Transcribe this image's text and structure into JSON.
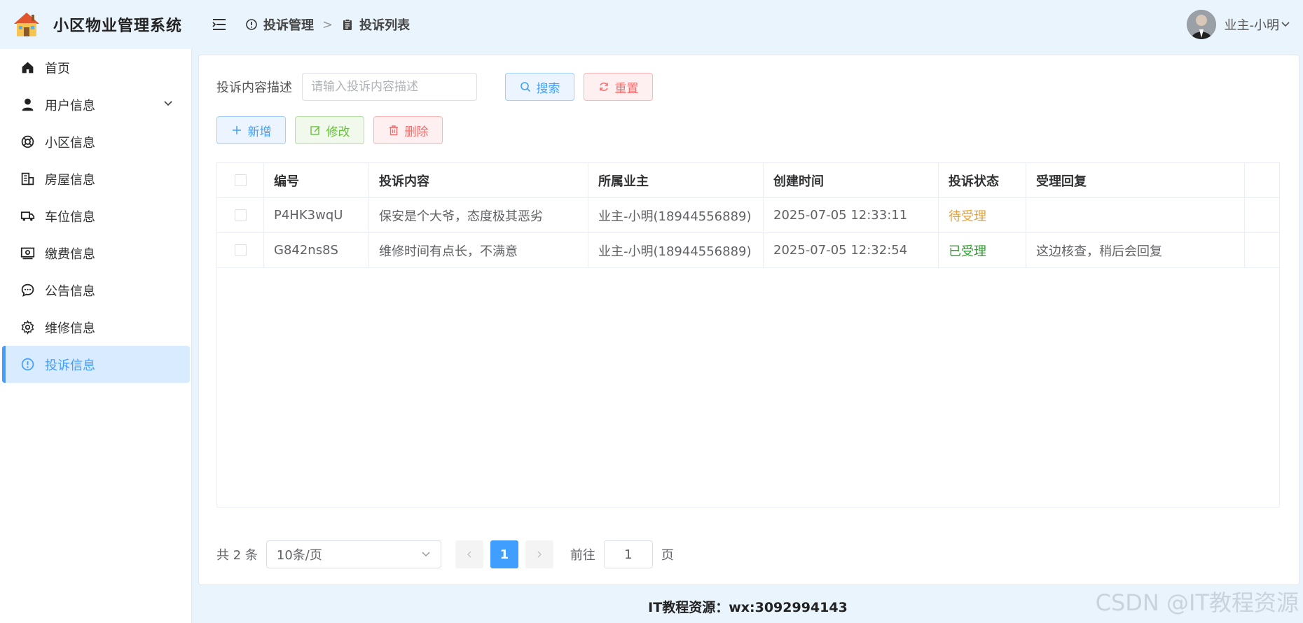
{
  "app": {
    "title": "小区物业管理系统"
  },
  "sidebar": {
    "items": [
      {
        "label": "首页",
        "icon": "home-icon"
      },
      {
        "label": "用户信息",
        "icon": "user-icon",
        "expandable": true
      },
      {
        "label": "小区信息",
        "icon": "lifebuoy-icon"
      },
      {
        "label": "房屋信息",
        "icon": "building-icon"
      },
      {
        "label": "车位信息",
        "icon": "truck-icon"
      },
      {
        "label": "缴费信息",
        "icon": "money-icon"
      },
      {
        "label": "公告信息",
        "icon": "chat-icon"
      },
      {
        "label": "维修信息",
        "icon": "gear-icon"
      },
      {
        "label": "投诉信息",
        "icon": "warning-icon",
        "active": true
      }
    ]
  },
  "header": {
    "breadcrumb": [
      "投诉管理",
      "投诉列表"
    ],
    "user_name": "业主-小明"
  },
  "search": {
    "label": "投诉内容描述",
    "placeholder": "请输入投诉内容描述",
    "value": "",
    "search_label": "搜索",
    "reset_label": "重置"
  },
  "actions": {
    "add_label": "新增",
    "edit_label": "修改",
    "delete_label": "删除"
  },
  "table": {
    "columns": [
      "编号",
      "投诉内容",
      "所属业主",
      "创建时间",
      "投诉状态",
      "受理回复"
    ],
    "rows": [
      {
        "id": "P4HK3wqU",
        "content": "保安是个大爷，态度极其恶劣",
        "owner": "业主-小明(18944556889)",
        "created": "2025-07-05 12:33:11",
        "status": "待受理",
        "reply": ""
      },
      {
        "id": "G842ns8S",
        "content": "维修时间有点长，不满意",
        "owner": "业主-小明(18944556889)",
        "created": "2025-07-05 12:32:54",
        "status": "已受理",
        "reply": "这边核查，稍后会回复"
      }
    ]
  },
  "pagination": {
    "total_text": "共 2 条",
    "page_size": "10条/页",
    "current_page": "1",
    "goto_prefix": "前往",
    "goto_value": "1",
    "goto_suffix": "页"
  },
  "footer": {
    "text": "IT教程资源：wx:3092994143"
  },
  "watermark": "CSDN @IT教程资源",
  "colors": {
    "accent": "#409eff",
    "pending": "#e6a23c",
    "done": "#2a9d2a",
    "danger": "#f56c6c",
    "success": "#67c23a"
  }
}
